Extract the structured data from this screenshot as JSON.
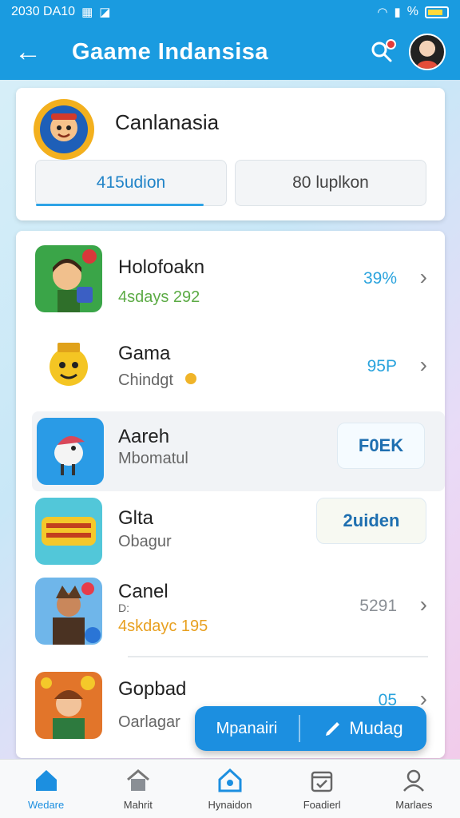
{
  "status_bar": {
    "time": "2030 DA10",
    "battery": "%"
  },
  "app_bar": {
    "title": "Gaame Indansisa"
  },
  "header": {
    "name": "Canlanasia",
    "tabs": [
      "415udion",
      "80 luplkon"
    ]
  },
  "games": [
    {
      "name": "Holofoakn",
      "sub": "4sdays 292",
      "metric": "39%",
      "metric_color": "#2aa3dd"
    },
    {
      "name": "Gama",
      "sub": "Chindgt",
      "metric": "95P",
      "metric_color": "#2aa3dd"
    },
    {
      "name": "Aareh",
      "sub": "Mbomatul",
      "button": "F0EK"
    },
    {
      "name": "Glta",
      "sub": "Obagur",
      "button": "2uiden"
    },
    {
      "name": "Canel",
      "sub_top": "D:",
      "sub": "4skdayc 195",
      "metric": "5291",
      "metric_color": "#8a8f95"
    },
    {
      "name": "Gopbad",
      "sub": "Oarlagar",
      "metric": "05",
      "metric_color": "#2aa3dd"
    }
  ],
  "float_pill": {
    "left": "Mpanairi",
    "right": "Mudag"
  },
  "nav": [
    {
      "label": "Wedare"
    },
    {
      "label": "Mahrit"
    },
    {
      "label": "Hynaidon"
    },
    {
      "label": "Foadierl"
    },
    {
      "label": "Marlaes"
    }
  ],
  "colors": {
    "primary": "#1a9be0",
    "accent": "#2aa3dd"
  }
}
